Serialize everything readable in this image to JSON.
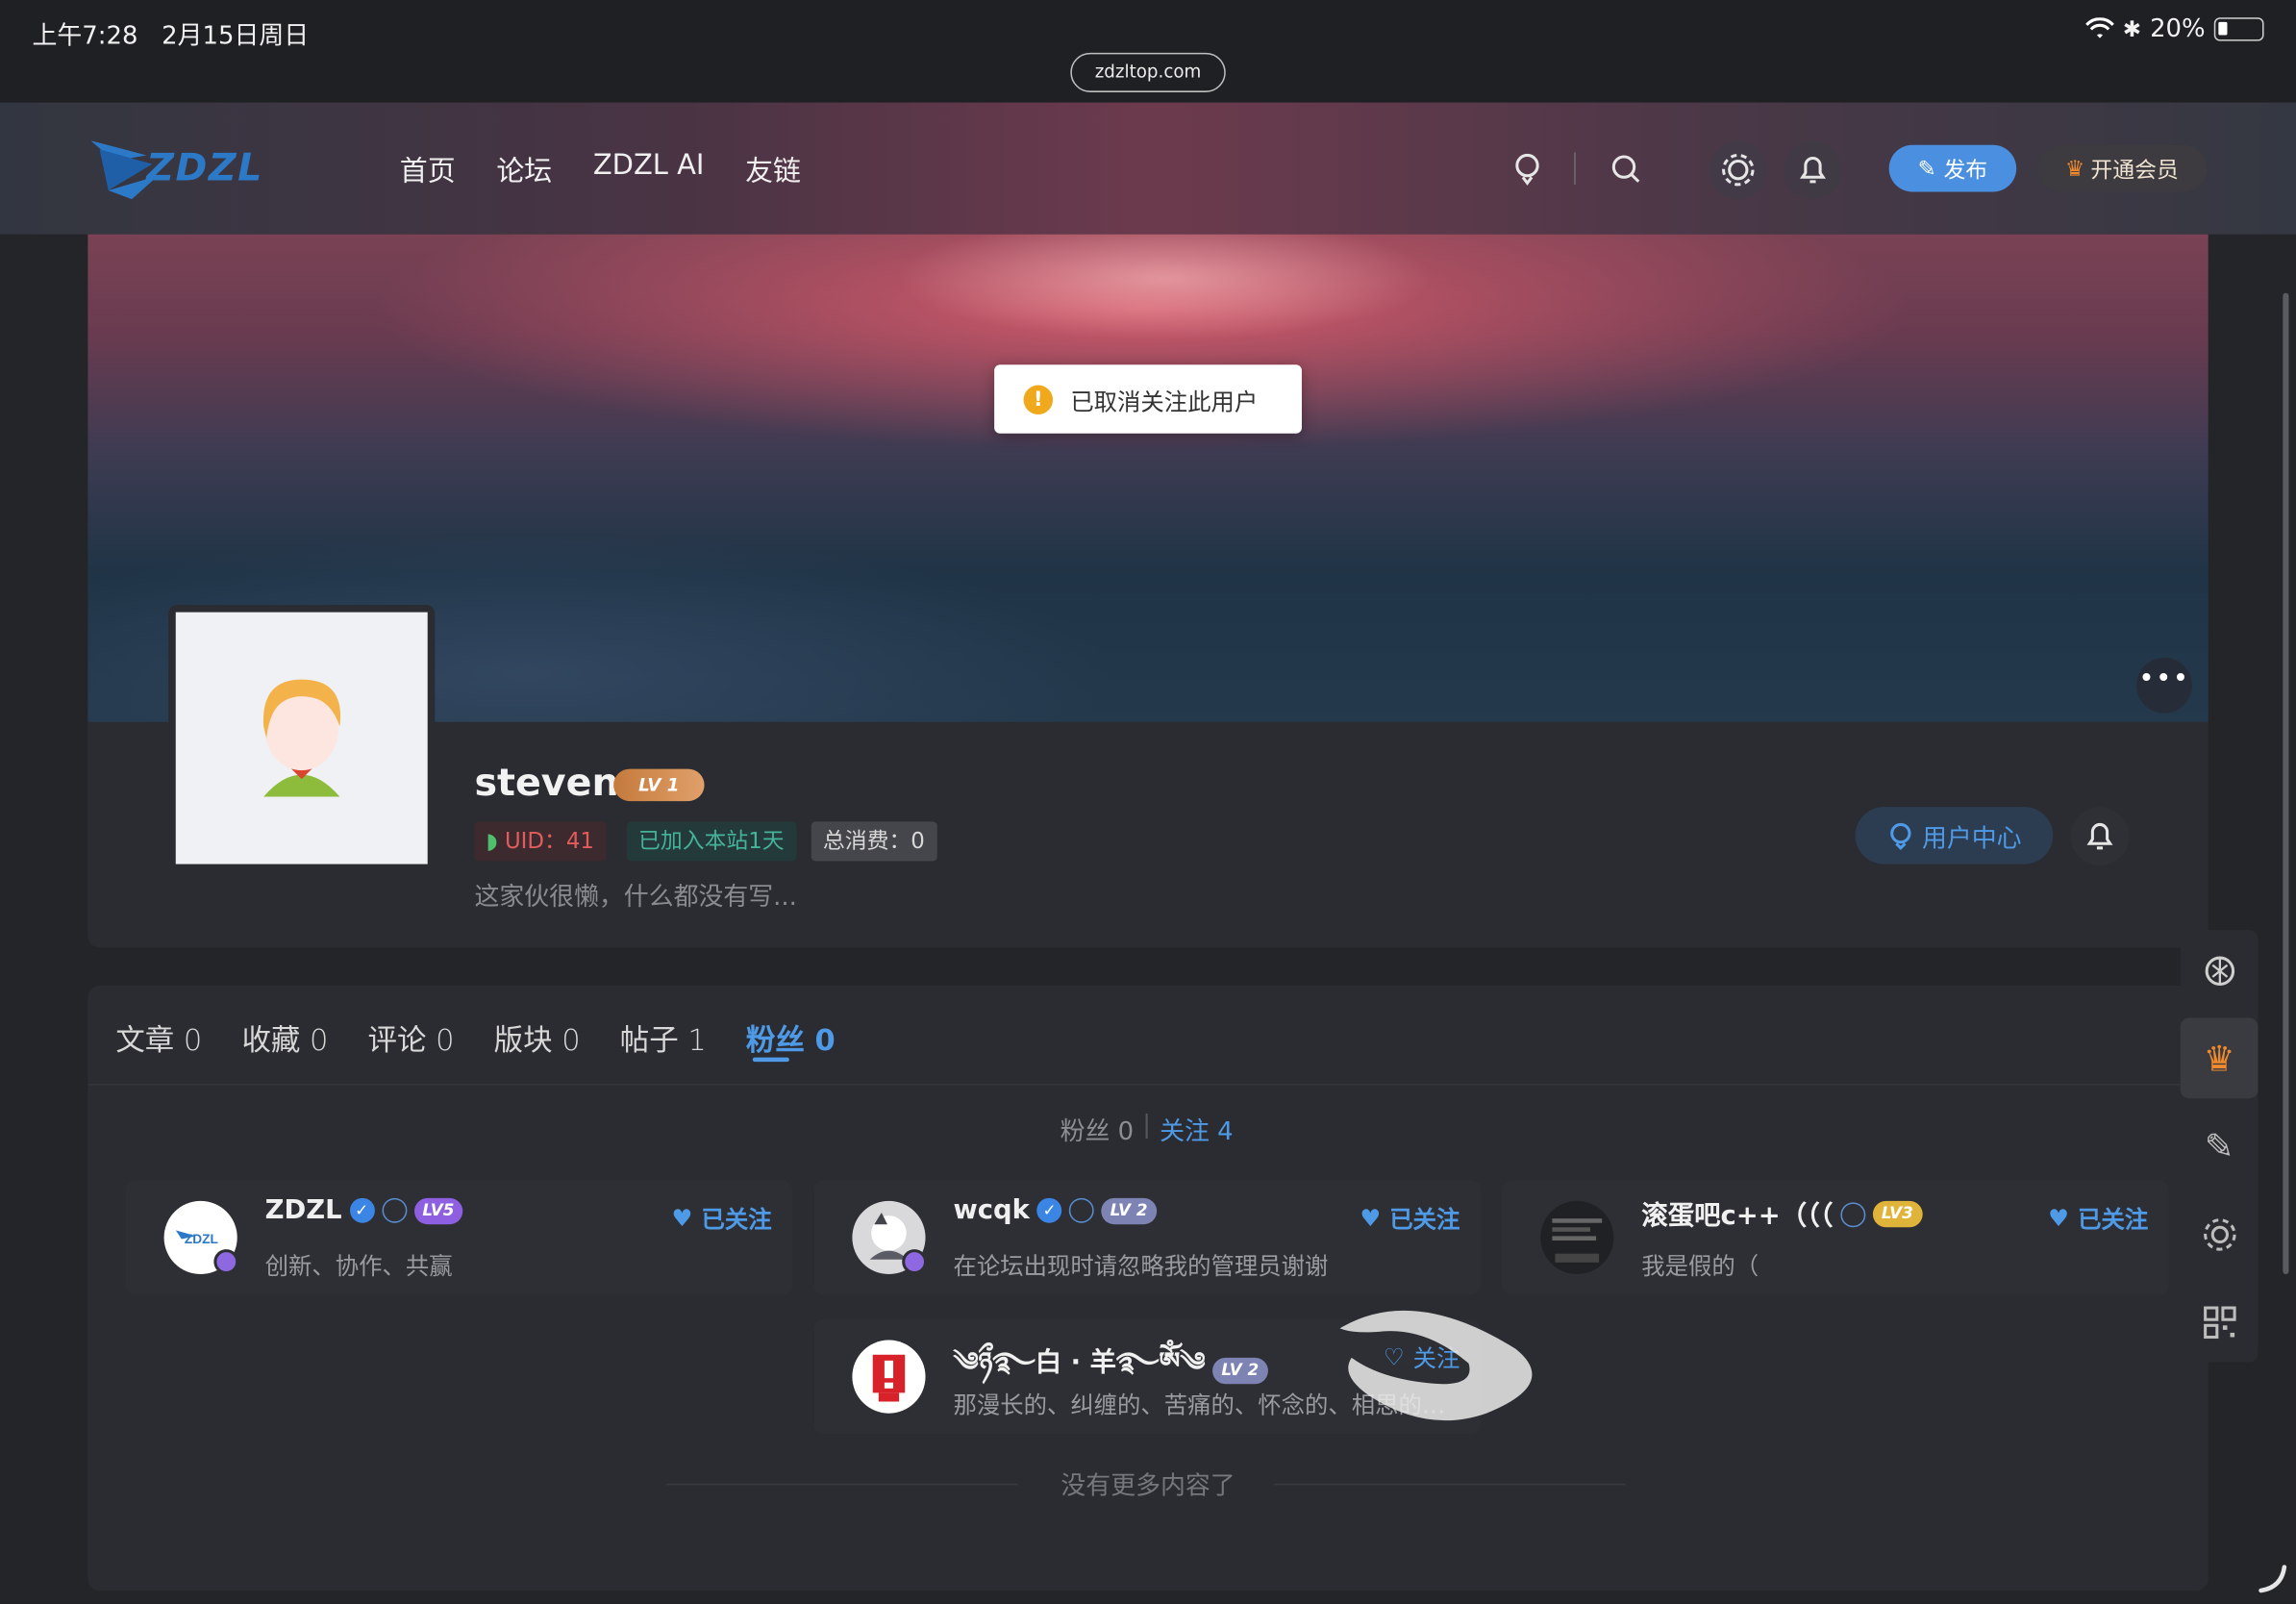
{
  "status_bar": {
    "time": "上午7:28",
    "date": "2月15日周日",
    "battery": "20%"
  },
  "address": {
    "url": "zdzltop.com"
  },
  "header": {
    "logo": "ZDZL",
    "nav": [
      "首页",
      "论坛",
      "ZDZL AI",
      "友链"
    ],
    "publish_label": "发布",
    "vip_label": "开通会员"
  },
  "toast": {
    "message": "已取消关注此用户"
  },
  "profile": {
    "username": "steven",
    "level": "LV 1",
    "uid": "UID：41",
    "joined": "已加入本站1天",
    "spent": "总消费：0",
    "bio": "这家伙很懒，什么都没有写...",
    "user_center_label": "用户中心"
  },
  "tabs": [
    {
      "label": "文章",
      "count": "0"
    },
    {
      "label": "收藏",
      "count": "0"
    },
    {
      "label": "评论",
      "count": "0"
    },
    {
      "label": "版块",
      "count": "0"
    },
    {
      "label": "帖子",
      "count": "1"
    },
    {
      "label": "粉丝",
      "count": "0"
    }
  ],
  "counts": {
    "fans": "粉丝 0",
    "sep": "|",
    "following": "关注 4"
  },
  "users": [
    {
      "name": "ZDZL",
      "level": "LV5",
      "desc": "创新、协作、共赢",
      "follow": "已关注"
    },
    {
      "name": "wcqk",
      "level": "LV 2",
      "desc": "在论坛出现时请忽略我的管理员谢谢",
      "follow": "已关注"
    },
    {
      "name": "滚蛋吧c++（（（",
      "level": "LV3",
      "desc": "我是假的（",
      "follow": "已关注"
    },
    {
      "name": "༄ཉྀ࿐白 · 羊࿐ༀ༄",
      "level": "LV 2",
      "desc": "那漫长的、纠缠的、苦痛的、怀念的、相思的…",
      "follow": "关注"
    }
  ],
  "no_more": "没有更多内容了",
  "colors": {
    "accent": "#4f9ae6",
    "publish": "#4b8fe0",
    "toast_warn": "#f0a81c"
  }
}
